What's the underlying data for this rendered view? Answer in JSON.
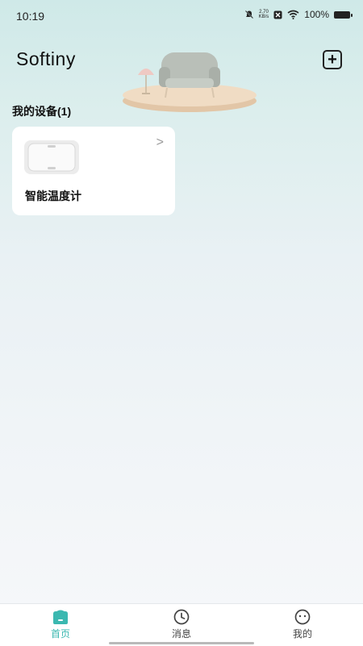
{
  "status": {
    "time": "10:19",
    "net_speed_value": "2.70",
    "net_speed_unit": "KB/s",
    "battery": "100%"
  },
  "header": {
    "title": "Softiny",
    "add_icon": "plus-square-icon"
  },
  "devices": {
    "section_title": "我的设备(1)",
    "items": [
      {
        "name": "智能温度计",
        "chevron": ">"
      }
    ]
  },
  "nav": {
    "items": [
      {
        "label": "首页",
        "icon": "home-icon",
        "active": true
      },
      {
        "label": "消息",
        "icon": "clock-icon",
        "active": false
      },
      {
        "label": "我的",
        "icon": "smiley-icon",
        "active": false
      }
    ],
    "accent": "#3bb8b0"
  }
}
